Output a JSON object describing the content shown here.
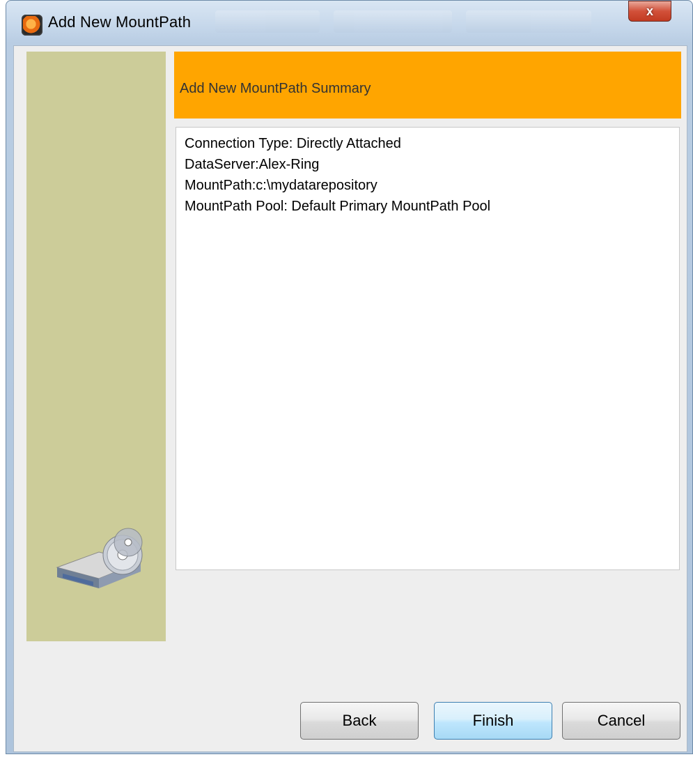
{
  "window": {
    "title": "Add New MountPath",
    "close_label": "x"
  },
  "header": {
    "title": "Add New MountPath Summary"
  },
  "summary": {
    "lines": [
      "Connection Type: Directly Attached",
      "DataServer:Alex-Ring",
      "MountPath:c:\\mydatarepository",
      "MountPath Pool: Default Primary MountPath Pool"
    ]
  },
  "buttons": {
    "back": "Back",
    "finish": "Finish",
    "cancel": "Cancel"
  },
  "icons": {
    "app": "app-logo-icon",
    "sidebar": "disk-drive-icon",
    "close": "close-icon"
  },
  "colors": {
    "sidebar": "#cccc99",
    "header": "#ffa500",
    "close": "#c23b22"
  }
}
